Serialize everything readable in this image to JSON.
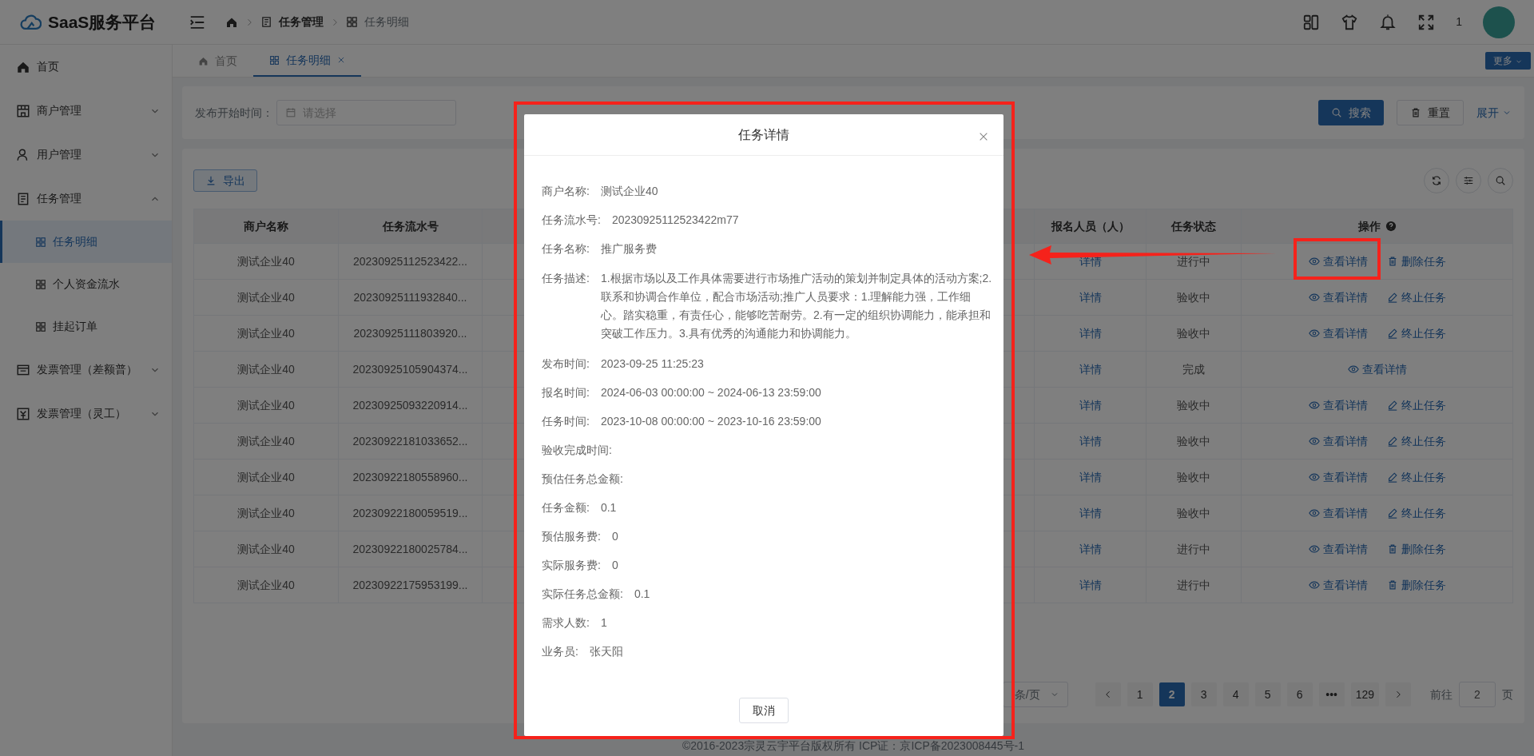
{
  "header": {
    "brand": "SaaS服务平台",
    "breadcrumb": [
      "任务管理",
      "任务明细"
    ],
    "count": "1"
  },
  "sidebar": {
    "items": [
      {
        "label": "首页"
      },
      {
        "label": "商户管理",
        "expanded": false
      },
      {
        "label": "用户管理",
        "expanded": false
      },
      {
        "label": "任务管理",
        "expanded": true,
        "children": [
          {
            "label": "任务明细",
            "selected": true
          },
          {
            "label": "个人资金流水",
            "selected": false
          },
          {
            "label": "挂起订单",
            "selected": false
          }
        ]
      },
      {
        "label": "发票管理（差额普）",
        "expanded": false
      },
      {
        "label": "发票管理（灵工）",
        "expanded": false
      }
    ]
  },
  "tabs": [
    {
      "label": "首页",
      "selected": false,
      "closable": false
    },
    {
      "label": "任务明细",
      "selected": true,
      "closable": true
    }
  ],
  "more_button": "更多",
  "search": {
    "fields": [
      {
        "label": "发布开始时间：",
        "placeholder": "请选择"
      }
    ],
    "search_button": "搜索",
    "reset_button": "重置",
    "expand_link": "展开"
  },
  "toolbar": {
    "export_button": "导出"
  },
  "table": {
    "columns": [
      "商户名称",
      "任务流水号",
      "",
      "报名人员（人）",
      "任务状态",
      "操作"
    ],
    "rows": [
      {
        "merchant": "测试企业40",
        "serial": "20230925112523422...",
        "signup": "详情",
        "status": "进行中",
        "actions": [
          {
            "kind": "view",
            "label": "查看详情"
          },
          {
            "kind": "delete",
            "label": "删除任务"
          }
        ]
      },
      {
        "merchant": "测试企业40",
        "serial": "20230925111932840...",
        "signup": "详情",
        "status": "验收中",
        "actions": [
          {
            "kind": "view",
            "label": "查看详情"
          },
          {
            "kind": "stop",
            "label": "终止任务"
          }
        ]
      },
      {
        "merchant": "测试企业40",
        "serial": "20230925111803920...",
        "signup": "详情",
        "status": "验收中",
        "actions": [
          {
            "kind": "view",
            "label": "查看详情"
          },
          {
            "kind": "stop",
            "label": "终止任务"
          }
        ]
      },
      {
        "merchant": "测试企业40",
        "serial": "20230925105904374...",
        "signup": "详情",
        "status": "完成",
        "actions": [
          {
            "kind": "view",
            "label": "查看详情"
          }
        ]
      },
      {
        "merchant": "测试企业40",
        "serial": "20230925093220914...",
        "signup": "详情",
        "status": "验收中",
        "actions": [
          {
            "kind": "view",
            "label": "查看详情"
          },
          {
            "kind": "stop",
            "label": "终止任务"
          }
        ]
      },
      {
        "merchant": "测试企业40",
        "serial": "20230922181033652...",
        "signup": "详情",
        "status": "验收中",
        "actions": [
          {
            "kind": "view",
            "label": "查看详情"
          },
          {
            "kind": "stop",
            "label": "终止任务"
          }
        ]
      },
      {
        "merchant": "测试企业40",
        "serial": "20230922180558960...",
        "signup": "详情",
        "status": "验收中",
        "actions": [
          {
            "kind": "view",
            "label": "查看详情"
          },
          {
            "kind": "stop",
            "label": "终止任务"
          }
        ]
      },
      {
        "merchant": "测试企业40",
        "serial": "20230922180059519...",
        "signup": "详情",
        "status": "验收中",
        "actions": [
          {
            "kind": "view",
            "label": "查看详情"
          },
          {
            "kind": "stop",
            "label": "终止任务"
          }
        ]
      },
      {
        "merchant": "测试企业40",
        "serial": "20230922180025784...",
        "signup": "详情",
        "status": "进行中",
        "actions": [
          {
            "kind": "view",
            "label": "查看详情"
          },
          {
            "kind": "delete",
            "label": "删除任务"
          }
        ]
      },
      {
        "merchant": "测试企业40",
        "serial": "20230922175953199...",
        "signup": "详情",
        "status": "进行中",
        "actions": [
          {
            "kind": "view",
            "label": "查看详情"
          },
          {
            "kind": "delete",
            "label": "删除任务"
          }
        ]
      }
    ]
  },
  "pagination": {
    "page_size": "条/页",
    "pages": [
      {
        "label": "1",
        "selected": false
      },
      {
        "label": "2",
        "selected": true
      },
      {
        "label": "3",
        "selected": false
      },
      {
        "label": "4",
        "selected": false
      },
      {
        "label": "5",
        "selected": false
      },
      {
        "label": "6",
        "selected": false
      },
      {
        "label": "•••",
        "selected": false
      },
      {
        "label": "129",
        "selected": false
      }
    ],
    "goto_label": "前往",
    "goto_value": "2",
    "page_unit": "页"
  },
  "footer": "©2016-2023宗灵云宇平台版权所有 ICP证：京ICP备2023008445号-1",
  "modal": {
    "title": "任务详情",
    "fields": [
      {
        "label": "商户名称:",
        "value": "测试企业40"
      },
      {
        "label": "任务流水号:",
        "value": "20230925112523422m77"
      },
      {
        "label": "任务名称:",
        "value": "推广服务费"
      },
      {
        "label": "任务描述:",
        "value": "1.根据市场以及工作具体需要进行市场推广活动的策划并制定具体的活动方案;2.联系和协调合作单位，配合市场活动;推广人员要求：1.理解能力强，工作细心。踏实稳重，有责任心，能够吃苦耐劳。2.有一定的组织协调能力，能承担和突破工作压力。3.具有优秀的沟通能力和协调能力。"
      },
      {
        "label": "发布时间:",
        "value": "2023-09-25 11:25:23"
      },
      {
        "label": "报名时间:",
        "value": "2024-06-03 00:00:00 ~ 2024-06-13 23:59:00"
      },
      {
        "label": "任务时间:",
        "value": "2023-10-08 00:00:00 ~ 2023-10-16 23:59:00"
      },
      {
        "label": "验收完成时间:"
      },
      {
        "label": "预估任务总金额:"
      },
      {
        "label": "任务金额:",
        "value": "0.1"
      },
      {
        "label": "预估服务费:",
        "value": "0"
      },
      {
        "label": "实际服务费:",
        "value": "0"
      },
      {
        "label": "实际任务总金额:",
        "value": "0.1"
      },
      {
        "label": "需求人数:",
        "value": "1"
      },
      {
        "label": "业务员:",
        "value": "张天阳"
      }
    ],
    "cancel_button": "取消"
  }
}
